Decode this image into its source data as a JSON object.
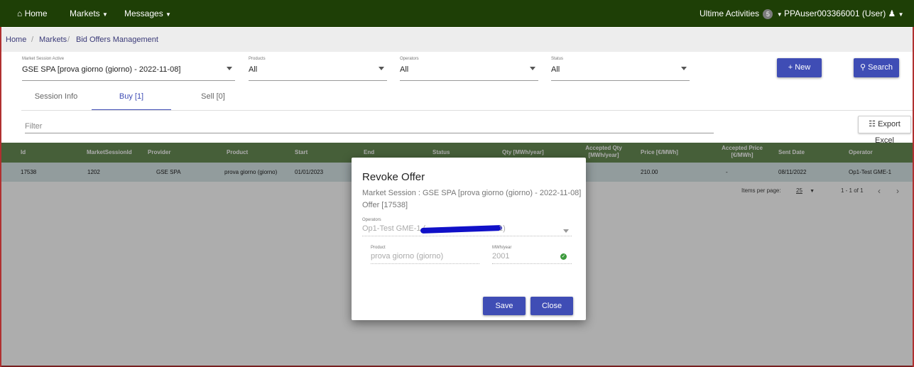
{
  "nav": {
    "home": "Home",
    "markets": "Markets",
    "messages": "Messages",
    "activities_label": "Ultime Activities",
    "activities_count": "5",
    "user": "PPAuser003366001 (User)"
  },
  "breadcrumb": [
    "Home",
    "Markets",
    "Bid Offers Management"
  ],
  "filters": {
    "market_session": {
      "label": "Market Session Active",
      "value": "GSE SPA [prova giorno (giorno) - 2022-11-08]"
    },
    "products": {
      "label": "Products",
      "value": "All"
    },
    "operators": {
      "label": "Operators",
      "value": "All"
    },
    "status": {
      "label": "Status",
      "value": "All"
    }
  },
  "buttons": {
    "new": "+ New",
    "search": "Search",
    "export": "Export Excel"
  },
  "tabs": [
    "Session Info",
    "Buy [1]",
    "Sell [0]"
  ],
  "filter_placeholder": "Filter",
  "table": {
    "columns": [
      "Id",
      "MarketSessionId",
      "Provider",
      "Product",
      "Start",
      "End",
      "Status",
      "Qty [MWh/year]",
      "Accepted Qty [MWh/year]",
      "Price [€/MWh]",
      "Accepted Price [€/MWh]",
      "Sent Date",
      "Operator"
    ],
    "accepted_qty_lines": [
      "Accepted Qty",
      "[MWh/year]"
    ],
    "accepted_price_lines": [
      "Accepted Price",
      "[€/MWh]"
    ],
    "row": {
      "id": "17538",
      "market_session_id": "1202",
      "provider": "GSE SPA",
      "product": "prova giorno (giorno)",
      "start": "01/01/2023",
      "price": "210.00",
      "accepted_price": "-",
      "sent_date": "08/11/2022",
      "operator": "Op1-Test GME-1"
    }
  },
  "paginator": {
    "items_label": "Items per page:",
    "page_size": "25",
    "range": "1 - 1 of 1"
  },
  "modal": {
    "title": "Revoke Offer",
    "market_session": "Market Session : GSE SPA [prova giorno (giorno) - 2022-11-08]",
    "offer": "Offer [17538]",
    "operators_label": "Operators",
    "operators_value_start": "Op1-Test GME-1 (",
    "operators_value_end": "1)",
    "product_label": "Product",
    "product_value": "prova giorno (giorno)",
    "mwh_label": "MWh/year",
    "mwh_value": "2001",
    "save": "Save",
    "close": "Close"
  },
  "colors": {
    "nav": "#1e3f06",
    "primary": "#3f4db5",
    "table_header": "#688c55",
    "row_selected": "#d8e6e8",
    "redaction": "#1010c8"
  }
}
